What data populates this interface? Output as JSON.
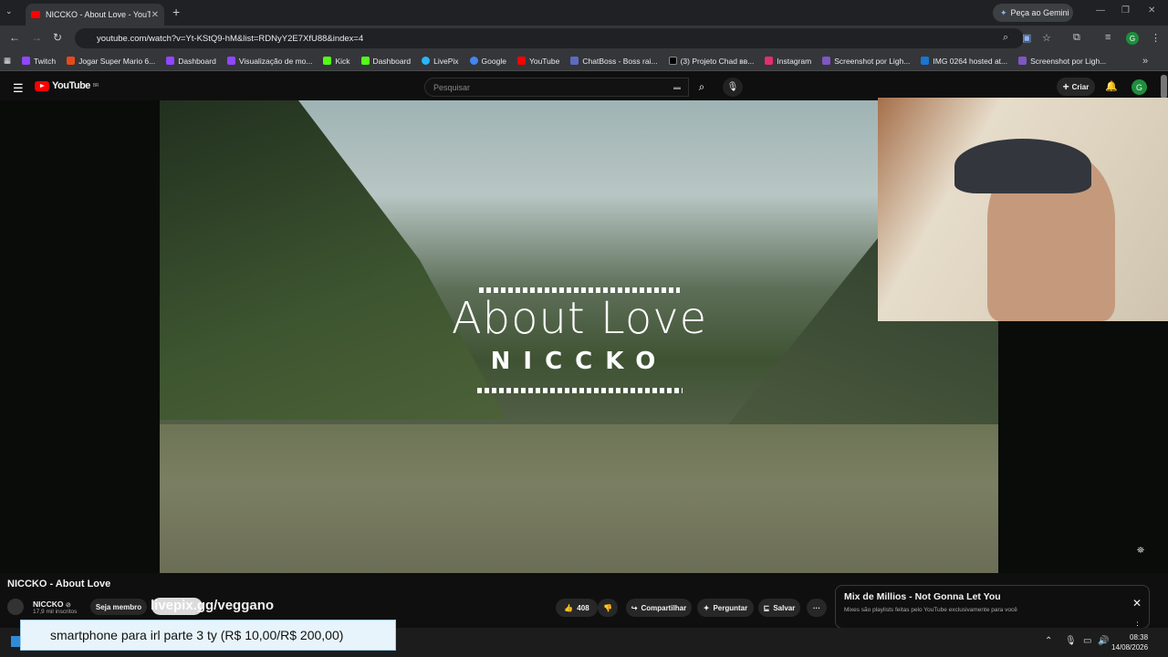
{
  "browser": {
    "tab_title": "NICCKO - About Love - YouTube",
    "tab_close": "✕",
    "new_tab": "+",
    "gemini_label": "Peça ao Gemini",
    "url": "youtube.com/watch?v=Yt-KStQ9-hM&list=RDNyY2E7XfU88&index=4",
    "profile_initial": "G",
    "bookmarks": [
      {
        "label": "Twitch",
        "color": "#9146ff"
      },
      {
        "label": "Jogar Super Mario 6...",
        "color": "#e64a19"
      },
      {
        "label": "Dashboard",
        "color": "#9146ff"
      },
      {
        "label": "Visualização de mo...",
        "color": "#9146ff"
      },
      {
        "label": "Kick",
        "color": "#53fc18"
      },
      {
        "label": "Dashboard",
        "color": "#53fc18"
      },
      {
        "label": "LivePix",
        "color": "#29b6f6"
      },
      {
        "label": "Google",
        "color": "#4285f4"
      },
      {
        "label": "YouTube",
        "color": "#ff0000"
      },
      {
        "label": "ChatBoss - Boss rai...",
        "color": "#5c6bc0"
      },
      {
        "label": "(3) Projeto Chad вв...",
        "color": "#000000"
      },
      {
        "label": "Instagram",
        "color": "#e1306c"
      },
      {
        "label": "Screenshot por Ligh...",
        "color": "#7e57c2"
      },
      {
        "label": "IMG 0264 hosted at...",
        "color": "#1976d2"
      },
      {
        "label": "Screenshot por Ligh...",
        "color": "#7e57c2"
      }
    ]
  },
  "youtube": {
    "logo_text": "YouTube",
    "logo_region": "BR",
    "search_placeholder": "Pesquisar",
    "create_label": "Criar",
    "avatar_initial": "G"
  },
  "video": {
    "art_title": "About Love",
    "art_artist": "NICCKO",
    "title": "NICCKO - About Love",
    "channel": "NICCKO",
    "verified": "⊘",
    "subscribers": "17,9 mil inscritos",
    "join_label": "Seja membro",
    "overlay_text": "livepix.gg/veggano",
    "likes": "408",
    "share_label": "Compartilhar",
    "ask_label": "Perguntar",
    "save_label": "Salvar",
    "more": "···"
  },
  "mix": {
    "title": "Mix de Millios - Not Gonna Let You",
    "subtitle": "Mixes são playlists feitas pelo YouTube exclusivamente para você",
    "close": "✕",
    "more": "⋮"
  },
  "notification": {
    "text": "smartphone para irl parte 3 ty (R$ 10,00/R$ 200,00)"
  },
  "taskbar": {
    "time": "08:38",
    "date": "14/08/2026"
  }
}
